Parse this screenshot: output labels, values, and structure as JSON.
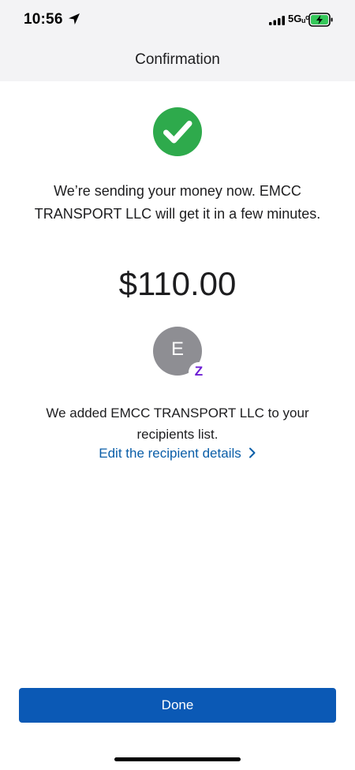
{
  "status_bar": {
    "time": "10:56",
    "network": "5Gᵤᶜ"
  },
  "nav": {
    "title": "Confirmation"
  },
  "confirmation": {
    "message": "We’re sending your money now. EMCC TRANSPORT LLC will get it in a few minutes.",
    "amount": "$110.00",
    "avatar_initial": "E",
    "badge_glyph": "Z",
    "recipient_note": "We added EMCC TRANSPORT LLC to your recipients list.",
    "edit_link_label": "Edit the recipient details"
  },
  "actions": {
    "done_label": "Done"
  },
  "icons": {
    "success": "checkmark-circle-icon",
    "location": "location-arrow-icon",
    "signal": "cellular-signal-icon",
    "battery": "battery-charging-icon",
    "chevron": "chevron-right-icon",
    "badge": "zelle-logo-icon"
  },
  "colors": {
    "success_green": "#2eaa4c",
    "link_blue": "#0a5ea8",
    "primary_button": "#0b59b5",
    "avatar_gray": "#8e8e93",
    "zelle_purple": "#6d1ed4",
    "battery_green": "#34c759",
    "header_bg": "#f3f3f5"
  }
}
